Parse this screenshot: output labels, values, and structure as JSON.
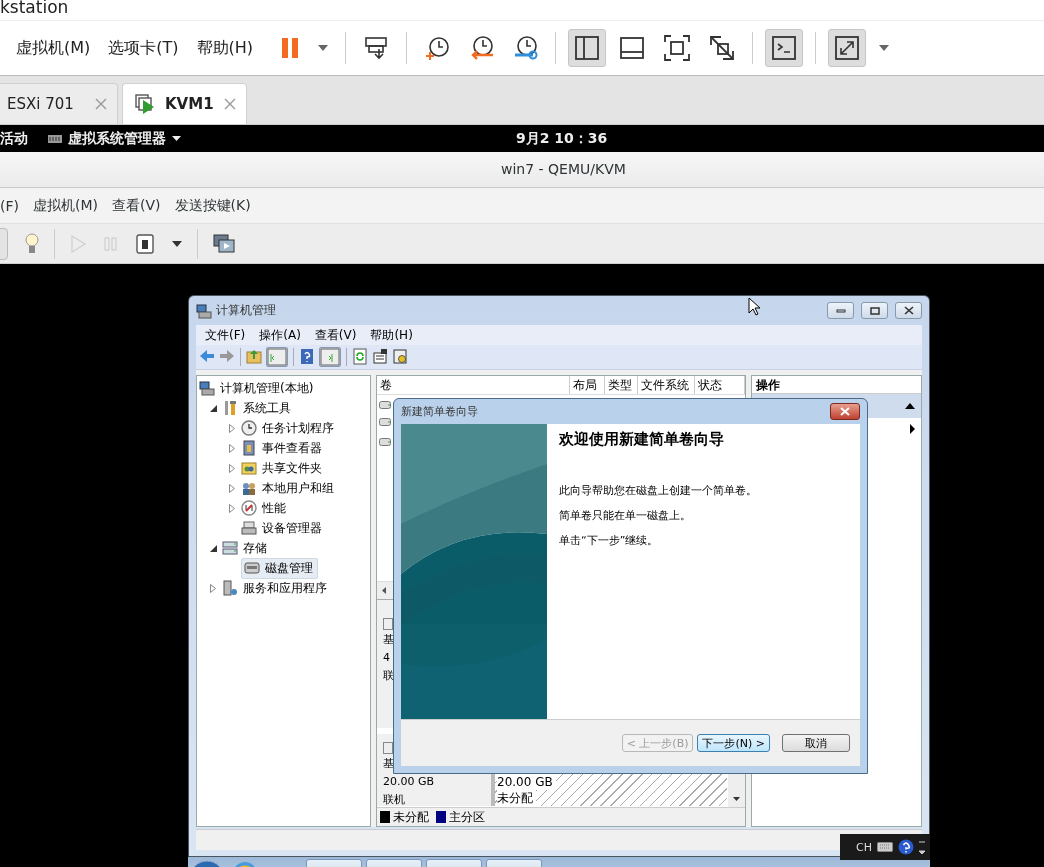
{
  "host_window": {
    "title": "kstation"
  },
  "menu": [
    "虚拟机(M)",
    "选项卡(T)",
    "帮助(H)"
  ],
  "toolbar": [
    {
      "kind": "pause",
      "pressed": false
    },
    {
      "kind": "dropdown",
      "pressed": false
    },
    {
      "kind": "separator"
    },
    {
      "kind": "send-keys",
      "pressed": false
    },
    {
      "kind": "separator"
    },
    {
      "kind": "snapshot",
      "pressed": false
    },
    {
      "kind": "revert",
      "pressed": false
    },
    {
      "kind": "snapshot-manager",
      "pressed": false
    },
    {
      "kind": "separator"
    },
    {
      "kind": "sidebar",
      "pressed": true
    },
    {
      "kind": "thumbnail-bar",
      "pressed": false
    },
    {
      "kind": "fullscreen",
      "pressed": false
    },
    {
      "kind": "unity",
      "pressed": false
    },
    {
      "kind": "separator"
    },
    {
      "kind": "console",
      "pressed": true
    },
    {
      "kind": "separator"
    },
    {
      "kind": "stretch",
      "pressed": true
    },
    {
      "kind": "dropdown",
      "pressed": false
    }
  ],
  "tabs": [
    {
      "label": "ESXi 701",
      "selected": false
    },
    {
      "label": "KVM1",
      "selected": true
    }
  ],
  "gnome_bar": {
    "activities": "活动",
    "app_menu": "虚拟系统管理器",
    "clock": "9月2 10：36"
  },
  "virt_manager": {
    "title": "win7 - QEMU/KVM",
    "menu": [
      "(F)",
      "虚拟机(M)",
      "查看(V)",
      "发送按键(K)"
    ],
    "toolbar": [
      {
        "kind": "console-view",
        "disabled": false
      },
      {
        "kind": "details",
        "disabled": false
      },
      {
        "kind": "separator"
      },
      {
        "kind": "run",
        "disabled": true
      },
      {
        "kind": "pause",
        "disabled": true
      },
      {
        "kind": "shutdown",
        "disabled": false
      },
      {
        "kind": "dropdown",
        "disabled": false
      },
      {
        "kind": "separator"
      },
      {
        "kind": "snapshots",
        "disabled": false
      }
    ]
  },
  "guest": {
    "window": {
      "title": "计算机管理",
      "menu": [
        "文件(F)",
        "操作(A)",
        "查看(V)",
        "帮助(H)"
      ],
      "tree": [
        {
          "label": "计算机管理(本地)",
          "selected": false,
          "children": [
            {
              "label": "系统工具",
              "expanded": true,
              "selected": false,
              "children": [
                {
                  "label": "任务计划程序",
                  "expanded": false,
                  "selected": false
                },
                {
                  "label": "事件查看器",
                  "expanded": false,
                  "selected": false
                },
                {
                  "label": "共享文件夹",
                  "expanded": false,
                  "selected": false
                },
                {
                  "label": "本地用户和组",
                  "expanded": false,
                  "selected": false
                },
                {
                  "label": "性能",
                  "expanded": false,
                  "selected": false
                },
                {
                  "label": "设备管理器",
                  "selected": false
                }
              ]
            },
            {
              "label": "存储",
              "expanded": true,
              "selected": false,
              "children": [
                {
                  "label": "磁盘管理",
                  "selected": true
                }
              ]
            },
            {
              "label": "服务和应用程序",
              "expanded": false,
              "selected": false
            }
          ]
        }
      ],
      "columns": [
        "卷",
        "布局",
        "类型",
        "文件系统",
        "状态"
      ],
      "disks": [
        {
          "lines": [
            "基",
            "4",
            "联"
          ]
        },
        {
          "lines": [
            "基",
            "20.00 GB",
            "联机"
          ],
          "partition": [
            "20.00 GB",
            "未分配"
          ]
        }
      ],
      "legend": [
        {
          "label": "未分配",
          "color": "#000000"
        },
        {
          "label": "主分区",
          "color": "#000080"
        }
      ],
      "actions_header": "操作"
    },
    "dialog": {
      "title": "新建简单卷向导",
      "heading": "欢迎使用新建简单卷向导",
      "paragraphs": [
        "此向导帮助您在磁盘上创建一个简单卷。",
        "简单卷只能在单一磁盘上。",
        "单击“下一步”继续。"
      ],
      "buttons": [
        {
          "label": "< 上一步(B)",
          "disabled": true,
          "default": false
        },
        {
          "label": "下一步(N) >",
          "disabled": false,
          "default": true
        },
        {
          "label": "取消",
          "disabled": false,
          "default": false
        }
      ]
    },
    "language_bar": {
      "label": "CH"
    }
  }
}
